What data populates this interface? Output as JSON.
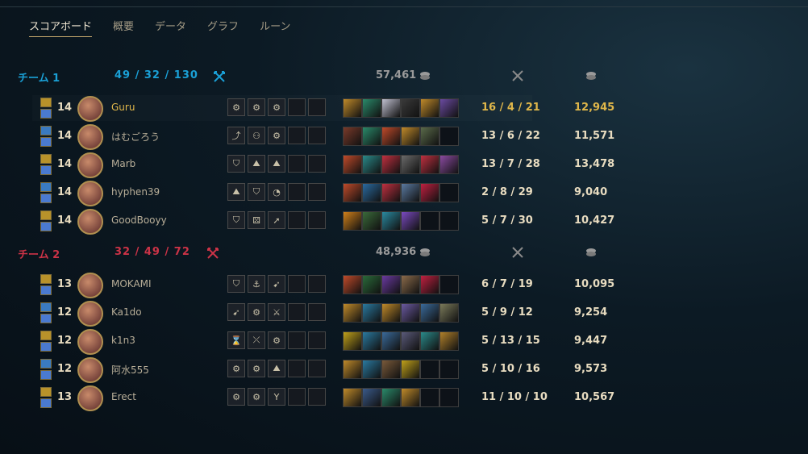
{
  "tabs": [
    "スコアボード",
    "概要",
    "データ",
    "グラフ",
    "ルーン"
  ],
  "colors": {
    "blue_team": "#1aa0d6",
    "red_team": "#cc3347",
    "highlight": "#e0b74a"
  },
  "team1": {
    "name": "チーム 1",
    "kda": "49 / 32 / 130",
    "gold": "57,461",
    "players": [
      {
        "level": "14",
        "name": "Guru",
        "kda": "16 / 4 / 21",
        "gold": "12,945",
        "me": true,
        "runes": [
          "⚙",
          "⚙",
          "⚙",
          "",
          ""
        ],
        "items": [
          "#c08a2a",
          "#2a8a6a",
          "#c0c0d0",
          "#3a3a3a",
          "#c08a2a",
          "#6a4aa0"
        ]
      },
      {
        "level": "14",
        "name": "はむごろう",
        "kda": "13 / 6 / 22",
        "gold": "11,571",
        "runes": [
          "⤴",
          "⚇",
          "⚙",
          "",
          ""
        ],
        "items": [
          "#7a3a2a",
          "#2a8a6a",
          "#c04a2a",
          "#c08a2a",
          "#5a6a4a",
          "empty"
        ]
      },
      {
        "level": "14",
        "name": "Marb",
        "kda": "13 / 7 / 28",
        "gold": "13,478",
        "runes": [
          "⛉",
          "⛰",
          "⛰",
          "",
          ""
        ],
        "items": [
          "#c04a2a",
          "#2a8a8a",
          "#c03040",
          "#6a6a6a",
          "#c03040",
          "#8a4aa0"
        ]
      },
      {
        "level": "14",
        "name": "hyphen39",
        "kda": "2 / 8 / 29",
        "gold": "9,040",
        "runes": [
          "⛰",
          "⛉",
          "◔",
          "",
          ""
        ],
        "items": [
          "#c04a2a",
          "#2a6aa0",
          "#c03040",
          "#5a7aa0",
          "#c02040",
          "empty"
        ]
      },
      {
        "level": "14",
        "name": "GoodBooyy",
        "kda": "5 / 7 / 30",
        "gold": "10,427",
        "runes": [
          "⛉",
          "⚄",
          "➚",
          "",
          ""
        ],
        "items": [
          "#d0801a",
          "#3a6a3a",
          "#2a8aa0",
          "#7a4ac0",
          "empty",
          "empty"
        ]
      }
    ]
  },
  "team2": {
    "name": "チーム 2",
    "kda": "32 / 49 / 72",
    "gold": "48,936",
    "players": [
      {
        "level": "13",
        "name": "MOKAMI",
        "kda": "6 / 7 / 19",
        "gold": "10,095",
        "runes": [
          "⛉",
          "⚓",
          "➹",
          "",
          ""
        ],
        "items": [
          "#c04a2a",
          "#2a6a3a",
          "#6a3aa0",
          "#8a6a4a",
          "#c02040",
          "empty"
        ]
      },
      {
        "level": "12",
        "name": "Ka1do",
        "kda": "5 / 9 / 12",
        "gold": "9,254",
        "runes": [
          "➹",
          "⚙",
          "⚔",
          "",
          ""
        ],
        "items": [
          "#c08a2a",
          "#2a7aa0",
          "#c08a2a",
          "#6a5aa0",
          "#3a6a9a",
          "#7a7a5a"
        ]
      },
      {
        "level": "12",
        "name": "k1n3",
        "kda": "5 / 13 / 15",
        "gold": "9,447",
        "runes": [
          "⌛",
          "⤫",
          "⚙",
          "",
          ""
        ],
        "items": [
          "#c0a01a",
          "#2a7aa0",
          "#3a6a9a",
          "#5a5a7a",
          "#2a8a8a",
          "#b0802a"
        ]
      },
      {
        "level": "12",
        "name": "阿水555",
        "kda": "5 / 10 / 16",
        "gold": "9,573",
        "runes": [
          "⚙",
          "⚙",
          "⛰",
          "",
          ""
        ],
        "items": [
          "#c08a2a",
          "#2a7aa0",
          "#7a5a3a",
          "#c0a01a",
          "empty",
          "empty"
        ]
      },
      {
        "level": "13",
        "name": "Erect",
        "kda": "11 / 10 / 10",
        "gold": "10,567",
        "runes": [
          "⚙",
          "⚙",
          "Y",
          "",
          ""
        ],
        "items": [
          "#c08a2a",
          "#3a5a8a",
          "#2a8a6a",
          "#c08a2a",
          "empty",
          "empty"
        ]
      }
    ]
  }
}
